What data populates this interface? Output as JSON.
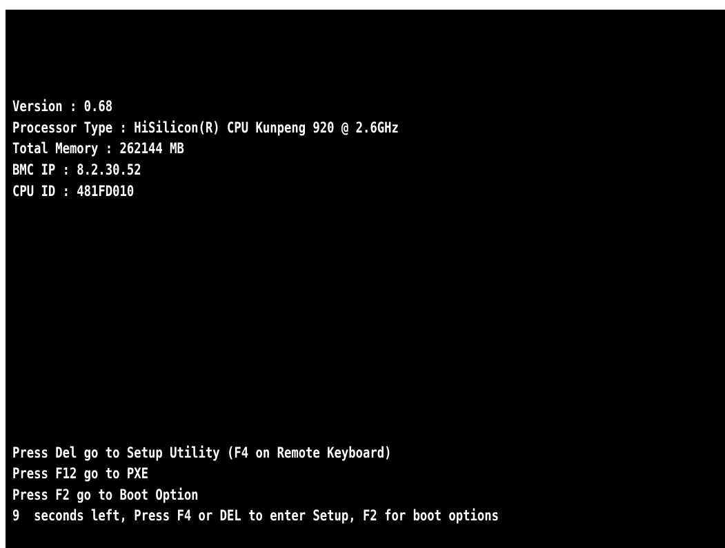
{
  "colors": {
    "background": "#000000",
    "text": "#ffffff",
    "frame": "#ffffff"
  },
  "system_info": [
    "Version : 0.68",
    "Processor Type : HiSilicon(R) CPU Kunpeng 920 @ 2.6GHz",
    "Total Memory : 262144 MB",
    "BMC IP : 8.2.30.52",
    "CPU ID : 481FD010"
  ],
  "prompts": [
    "Press Del go to Setup Utility (F4 on Remote Keyboard)",
    "Press F12 go to PXE",
    "Press F2 go to Boot Option",
    "9  seconds left, Press F4 or DEL to enter Setup, F2 for boot options"
  ]
}
